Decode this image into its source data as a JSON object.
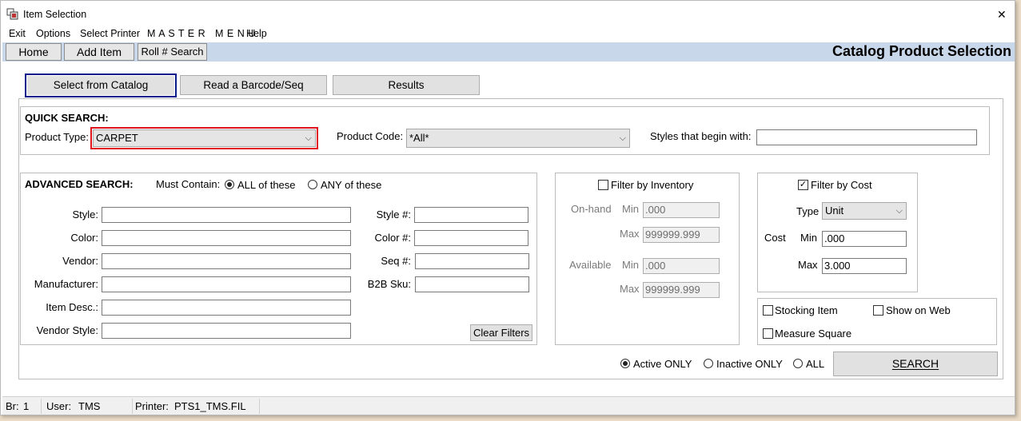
{
  "window": {
    "title": "Item Selection",
    "close_glyph": "✕"
  },
  "menu": {
    "items": [
      "Exit",
      "Options",
      "Select Printer",
      "M A S T E R   M E N U",
      "Help"
    ]
  },
  "toolbar": {
    "home_label": "Home",
    "add_item_label": "Add Item",
    "roll_search_label": "Roll # Search",
    "page_title": "Catalog Product Selection"
  },
  "tabs": [
    {
      "label": "Select from Catalog",
      "active": true
    },
    {
      "label": "Read a Barcode/Seq",
      "active": false
    },
    {
      "label": "Results",
      "active": false
    }
  ],
  "quick_search": {
    "title": "QUICK SEARCH:",
    "product_type_label": "Product Type:",
    "product_type_value": "CARPET",
    "product_code_label": "Product Code:",
    "product_code_value": "*All*",
    "styles_label": "Styles that begin with:",
    "styles_value": ""
  },
  "advanced_search": {
    "title": "ADVANCED SEARCH:",
    "must_contain_label": "Must Contain:",
    "all_label": "ALL of these",
    "any_label": "ANY of these",
    "all_selected": true,
    "fields_left": [
      {
        "label": "Style:",
        "value": ""
      },
      {
        "label": "Color:",
        "value": ""
      },
      {
        "label": "Vendor:",
        "value": ""
      },
      {
        "label": "Manufacturer:",
        "value": ""
      },
      {
        "label": "Item Desc.:",
        "value": ""
      },
      {
        "label": "Vendor Style:",
        "value": ""
      }
    ],
    "fields_right": [
      {
        "label": "Style #:",
        "value": ""
      },
      {
        "label": "Color #:",
        "value": ""
      },
      {
        "label": "Seq #:",
        "value": ""
      },
      {
        "label": "B2B Sku:",
        "value": ""
      }
    ],
    "clear_filters_label": "Clear Filters"
  },
  "inventory_filter": {
    "label": "Filter by Inventory",
    "checked": false,
    "onhand_label": "On-hand",
    "available_label": "Available",
    "min_label": "Min",
    "max_label": "Max",
    "onhand_min": ".000",
    "onhand_max": "999999.999",
    "available_min": ".000",
    "available_max": "999999.999"
  },
  "cost_filter": {
    "label": "Filter by Cost",
    "checked": true,
    "check_glyph": "✓",
    "type_label": "Type",
    "type_value": "Unit",
    "cost_label": "Cost",
    "min_label": "Min",
    "max_label": "Max",
    "min_value": ".000",
    "max_value": "3.000"
  },
  "options": {
    "stocking_item_label": "Stocking Item",
    "show_on_web_label": "Show on Web",
    "measure_square_label": "Measure Square"
  },
  "status_filter": {
    "active_label": "Active ONLY",
    "inactive_label": "Inactive ONLY",
    "all_label": "ALL",
    "selected": "active"
  },
  "search_button_label": "SEARCH",
  "statusbar": {
    "branch_label": "Br:",
    "branch_value": "1",
    "user_label": "User:",
    "user_value": "TMS",
    "printer_label": "Printer:",
    "printer_value": "PTS1_TMS.FIL"
  },
  "colors": {
    "toolbar_bg": "#c8d8ea",
    "active_tab_border": "#0a1a8c",
    "product_type_highlight": "#e0141e"
  }
}
